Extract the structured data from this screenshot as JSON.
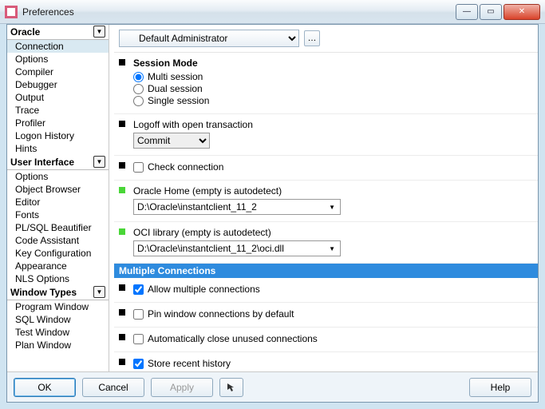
{
  "window": {
    "title": "Preferences"
  },
  "nav": {
    "sections": [
      {
        "title": "Oracle",
        "items": [
          "Connection",
          "Options",
          "Compiler",
          "Debugger",
          "Output",
          "Trace",
          "Profiler",
          "Logon History",
          "Hints"
        ],
        "selected": 0
      },
      {
        "title": "User Interface",
        "items": [
          "Options",
          "Object Browser",
          "Editor",
          "Fonts",
          "PL/SQL Beautifier",
          "Code Assistant",
          "Key Configuration",
          "Appearance",
          "NLS Options"
        ]
      },
      {
        "title": "Window Types",
        "items": [
          "Program Window",
          "SQL Window",
          "Test Window",
          "Plan Window"
        ]
      }
    ]
  },
  "profile": {
    "selected": "Default Administrator"
  },
  "session_mode": {
    "label": "Session Mode",
    "options": [
      "Multi session",
      "Dual session",
      "Single session"
    ],
    "selected": 0
  },
  "logoff": {
    "label": "Logoff with open transaction",
    "value": "Commit"
  },
  "check_conn": {
    "label": "Check connection",
    "checked": false
  },
  "oracle_home": {
    "label": "Oracle Home (empty is autodetect)",
    "value": "D:\\Oracle\\instantclient_11_2"
  },
  "oci_lib": {
    "label": "OCI library (empty is autodetect)",
    "value": "D:\\Oracle\\instantclient_11_2\\oci.dll"
  },
  "multi": {
    "header": "Multiple Connections",
    "allow": {
      "label": "Allow multiple connections",
      "checked": true
    },
    "pin": {
      "label": "Pin window connections by default",
      "checked": false
    },
    "autoclose": {
      "label": "Automatically close unused connections",
      "checked": false
    },
    "history": {
      "label": "Store recent history",
      "checked": true
    }
  },
  "buttons": {
    "ok": "OK",
    "cancel": "Cancel",
    "apply": "Apply",
    "help": "Help"
  }
}
